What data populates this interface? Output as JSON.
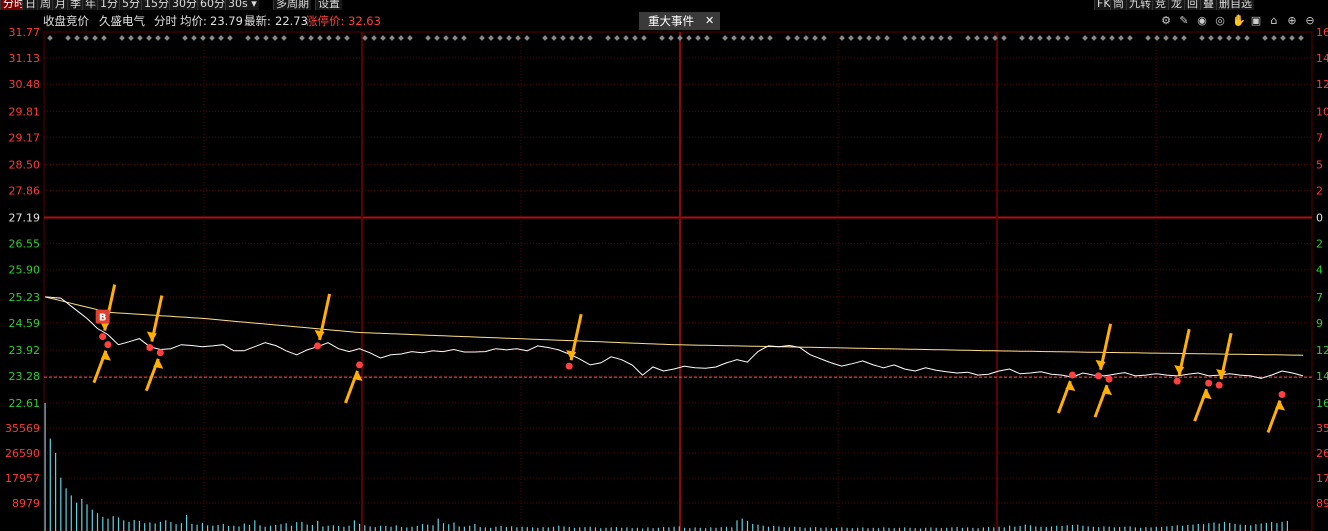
{
  "toolbar": {
    "left": [
      "分时",
      "日",
      "周",
      "月",
      "季",
      "年",
      "1分",
      "5分",
      "15分",
      "30分",
      "60分",
      "30s",
      "多周期",
      "设置"
    ],
    "right": [
      "FK",
      "筒",
      "九转",
      "竞",
      "龙",
      "回",
      "叠",
      "删自选"
    ]
  },
  "info": {
    "auction": "收盘竞价",
    "stock": "久盛电气",
    "mode": "分时",
    "avg_label": "均价:",
    "avg": "23.79",
    "last_label": "最新:",
    "last": "22.73",
    "limit_label": "涨停价:",
    "limit": "32.63"
  },
  "event_tab": {
    "label": "重大事件",
    "close": "✕"
  },
  "top_icons": [
    "gear-icon",
    "brush-icon",
    "eye-icon",
    "eye-outline-icon",
    "hand-icon",
    "lock-icon",
    "house-icon",
    "plus-icon",
    "minus-icon"
  ],
  "colors": {
    "price_line": "#ffffff",
    "avg_line": "#ffe08a",
    "grid": "#5a0000",
    "up": "#ff3a3a",
    "down": "#33cc33",
    "volume": "#5fd0e0",
    "arrow": "#ffb000",
    "marker": "#ff4040"
  },
  "chart_data": {
    "type": "line",
    "prev_close": 27.19,
    "price_axis": [
      "31.77",
      "31.13",
      "30.48",
      "29.81",
      "29.17",
      "28.50",
      "27.86",
      "27.19",
      "26.55",
      "25.90",
      "25.23",
      "24.59",
      "23.92",
      "23.28",
      "22.61"
    ],
    "pct_axis": [
      "16",
      "14",
      "12",
      "10",
      "7",
      "5",
      "2",
      "0",
      "2",
      "4",
      "7",
      "9",
      "12",
      "14",
      "16"
    ],
    "volume_axis": [
      "35569",
      "26590",
      "17957",
      "8979"
    ],
    "volume_axis_right": [
      "35",
      "26",
      "17",
      "89"
    ],
    "ylim": [
      22.61,
      31.77
    ],
    "x_count": 241,
    "price_keys": [
      [
        0,
        25.23
      ],
      [
        3,
        25.2
      ],
      [
        6,
        24.9
      ],
      [
        8,
        24.7
      ],
      [
        10,
        24.45
      ],
      [
        12,
        24.3
      ],
      [
        14,
        24.05
      ],
      [
        16,
        24.12
      ],
      [
        18,
        24.2
      ],
      [
        20,
        24.0
      ],
      [
        22,
        23.93
      ],
      [
        24,
        23.95
      ],
      [
        26,
        24.05
      ],
      [
        28,
        24.03
      ],
      [
        30,
        24.0
      ],
      [
        32,
        24.02
      ],
      [
        34,
        24.05
      ],
      [
        36,
        23.9
      ],
      [
        38,
        23.9
      ],
      [
        40,
        24.0
      ],
      [
        42,
        24.1
      ],
      [
        44,
        24.03
      ],
      [
        46,
        23.9
      ],
      [
        48,
        23.8
      ],
      [
        50,
        23.92
      ],
      [
        52,
        24.0
      ],
      [
        54,
        24.1
      ],
      [
        56,
        23.95
      ],
      [
        58,
        23.88
      ],
      [
        60,
        23.95
      ],
      [
        62,
        23.85
      ],
      [
        64,
        23.72
      ],
      [
        66,
        23.8
      ],
      [
        68,
        23.82
      ],
      [
        70,
        23.88
      ],
      [
        72,
        23.85
      ],
      [
        74,
        23.9
      ],
      [
        76,
        23.88
      ],
      [
        78,
        23.93
      ],
      [
        80,
        23.87
      ],
      [
        82,
        23.87
      ],
      [
        84,
        23.88
      ],
      [
        86,
        23.95
      ],
      [
        88,
        23.92
      ],
      [
        90,
        23.95
      ],
      [
        92,
        23.9
      ],
      [
        94,
        24.02
      ],
      [
        96,
        23.98
      ],
      [
        98,
        23.92
      ],
      [
        100,
        23.82
      ],
      [
        102,
        23.7
      ],
      [
        104,
        23.55
      ],
      [
        106,
        23.6
      ],
      [
        108,
        23.75
      ],
      [
        110,
        23.68
      ],
      [
        112,
        23.55
      ],
      [
        114,
        23.3
      ],
      [
        116,
        23.5
      ],
      [
        118,
        23.4
      ],
      [
        120,
        23.45
      ],
      [
        122,
        23.52
      ],
      [
        124,
        23.48
      ],
      [
        126,
        23.47
      ],
      [
        128,
        23.5
      ],
      [
        130,
        23.6
      ],
      [
        132,
        23.68
      ],
      [
        134,
        23.62
      ],
      [
        136,
        23.88
      ],
      [
        138,
        24.02
      ],
      [
        140,
        24.0
      ],
      [
        142,
        24.03
      ],
      [
        144,
        23.98
      ],
      [
        146,
        23.8
      ],
      [
        148,
        23.7
      ],
      [
        150,
        23.6
      ],
      [
        152,
        23.52
      ],
      [
        154,
        23.58
      ],
      [
        156,
        23.65
      ],
      [
        158,
        23.55
      ],
      [
        160,
        23.48
      ],
      [
        162,
        23.55
      ],
      [
        164,
        23.45
      ],
      [
        166,
        23.4
      ],
      [
        168,
        23.48
      ],
      [
        170,
        23.42
      ],
      [
        172,
        23.38
      ],
      [
        174,
        23.35
      ],
      [
        176,
        23.37
      ],
      [
        178,
        23.3
      ],
      [
        180,
        23.32
      ],
      [
        182,
        23.4
      ],
      [
        184,
        23.45
      ],
      [
        186,
        23.33
      ],
      [
        188,
        23.35
      ],
      [
        190,
        23.38
      ],
      [
        192,
        23.32
      ],
      [
        194,
        23.3
      ],
      [
        196,
        23.25
      ],
      [
        198,
        23.35
      ],
      [
        200,
        23.3
      ],
      [
        202,
        23.28
      ],
      [
        204,
        23.32
      ],
      [
        206,
        23.36
      ],
      [
        208,
        23.28
      ],
      [
        210,
        23.3
      ],
      [
        212,
        23.33
      ],
      [
        214,
        23.3
      ],
      [
        216,
        23.28
      ],
      [
        218,
        23.32
      ],
      [
        220,
        23.35
      ],
      [
        222,
        23.28
      ],
      [
        224,
        23.3
      ],
      [
        226,
        23.33
      ],
      [
        228,
        23.3
      ],
      [
        230,
        23.28
      ],
      [
        232,
        23.22
      ],
      [
        234,
        23.3
      ],
      [
        236,
        23.4
      ],
      [
        238,
        23.35
      ],
      [
        240,
        23.28
      ]
    ],
    "price_note": "full-day price approximated from visible line",
    "avg_keys": [
      [
        0,
        25.23
      ],
      [
        12,
        24.85
      ],
      [
        30,
        24.7
      ],
      [
        60,
        24.35
      ],
      [
        120,
        24.05
      ],
      [
        180,
        23.9
      ],
      [
        240,
        23.79
      ]
    ],
    "markers": [
      {
        "i": 11,
        "price": 24.25,
        "label": "B"
      },
      {
        "i": 12,
        "price": 24.05
      },
      {
        "i": 20,
        "price": 23.98
      },
      {
        "i": 22,
        "price": 23.85
      },
      {
        "i": 52,
        "price": 24.02
      },
      {
        "i": 60,
        "price": 23.55
      },
      {
        "i": 100,
        "price": 23.52
      },
      {
        "i": 196,
        "price": 23.3
      },
      {
        "i": 201,
        "price": 23.28
      },
      {
        "i": 203,
        "price": 23.2
      },
      {
        "i": 216,
        "price": 23.15
      },
      {
        "i": 222,
        "price": 23.1
      },
      {
        "i": 224,
        "price": 23.05
      },
      {
        "i": 236,
        "price": 22.82
      }
    ],
    "volume": [
      36000,
      26000,
      22000,
      15000,
      12000,
      10000,
      8000,
      9000,
      7500,
      6000,
      5000,
      4000,
      3500,
      4200,
      3800,
      3000,
      2600,
      3100,
      2800,
      2200,
      2400,
      2100,
      2600,
      3000,
      2500,
      1900,
      2200,
      4500,
      2000,
      1800,
      2300,
      1600,
      1500,
      1700,
      2000,
      1400,
      1500,
      1300,
      2100,
      1700,
      3000,
      1600,
      1200,
      1500,
      1700,
      1900,
      2200,
      1500,
      2500,
      2600,
      1800,
      1700,
      2800,
      1300,
      1500,
      1600,
      1400,
      1200,
      1500,
      3000,
      2000,
      1600,
      1300,
      1100,
      1500,
      1400,
      1200,
      1600,
      1100,
      1000,
      1200,
      1400,
      2000,
      1800,
      1600,
      3500,
      2200,
      1900,
      2400,
      1300,
      1200,
      1500,
      2000,
      1100,
      1000,
      900,
      1200,
      1400,
      1100,
      1300,
      1000,
      1200,
      1100,
      1000,
      900,
      1100,
      1000,
      1200,
      1500,
      1300,
      1100,
      900,
      1000,
      1100,
      1200,
      1000,
      800,
      900,
      1000,
      1100,
      900,
      1000,
      800,
      900,
      700,
      1000,
      800,
      900,
      1100,
      1000,
      1200,
      1300,
      900,
      800,
      1000,
      900,
      800,
      1000,
      900,
      1100,
      1200,
      1000,
      3000,
      3500,
      2800,
      2000,
      1800,
      1500,
      1200,
      1400,
      1300,
      1100,
      1000,
      1200,
      1100,
      900,
      1000,
      1100,
      900,
      1000,
      800,
      900,
      1000,
      900,
      800,
      900,
      1000,
      800,
      900,
      800,
      1000,
      900,
      800,
      900,
      1000,
      900,
      800,
      700,
      900,
      1000,
      900,
      800,
      900,
      1000,
      1100,
      900,
      1000,
      900,
      800,
      1000,
      1100,
      1000,
      1200,
      1000,
      1500,
      1200,
      1400,
      1800,
      1600,
      1300,
      1200,
      1100,
      1300,
      1500,
      1400,
      1600,
      1700,
      1800,
      1500,
      1300,
      1200,
      1100,
      1300,
      1200,
      1000,
      1100,
      1200,
      1300,
      1000,
      900,
      1100,
      1000,
      1200,
      1100,
      1300,
      1400,
      1600,
      1500,
      1700,
      1800,
      2000,
      1900,
      2200,
      2400,
      2100,
      2600,
      2300,
      2000,
      1800,
      1700,
      1600,
      1900,
      2100,
      2300,
      2500,
      2200,
      2600,
      2800
    ]
  }
}
